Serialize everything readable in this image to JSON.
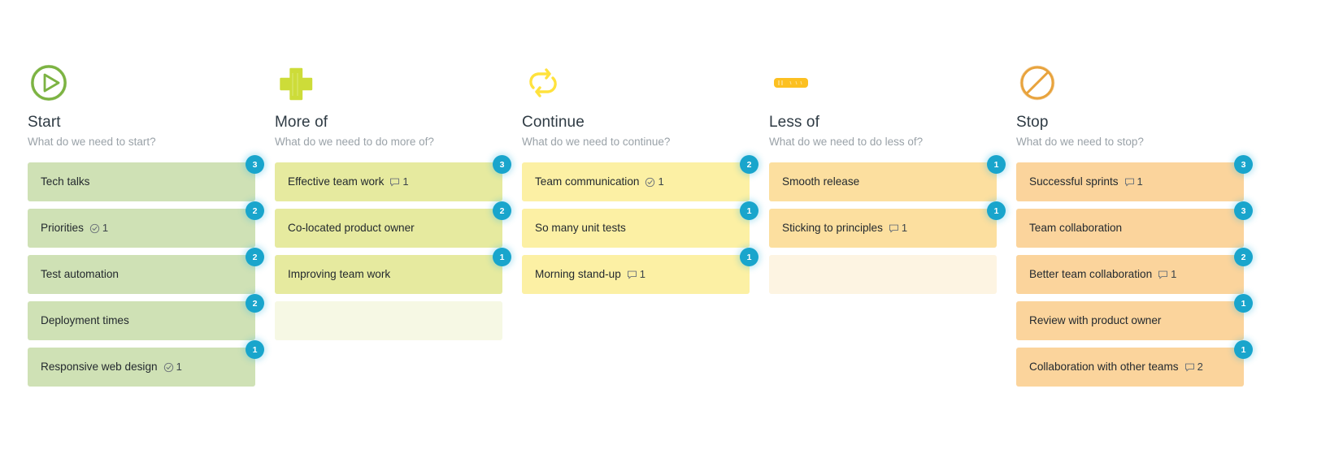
{
  "board": {
    "columns": [
      {
        "id": "start",
        "icon": "play-circle-icon",
        "icon_color": "#7cb342",
        "title": "Start",
        "prompt": "What do we need to start?",
        "card_color": "#cfe1b5",
        "cards": [
          {
            "text": "Tech talks",
            "badge": "3",
            "meta_icon": "",
            "meta_count": ""
          },
          {
            "text": "Priorities",
            "badge": "2",
            "meta_icon": "check-circle-icon",
            "meta_count": "1"
          },
          {
            "text": "Test automation",
            "badge": "2",
            "meta_icon": "",
            "meta_count": ""
          },
          {
            "text": "Deployment times",
            "badge": "2",
            "meta_icon": "",
            "meta_count": ""
          },
          {
            "text": "Responsive web design",
            "badge": "1",
            "meta_icon": "check-circle-icon",
            "meta_count": "1"
          }
        ]
      },
      {
        "id": "moreof",
        "icon": "plus-cross-icon",
        "icon_color": "#cddc39",
        "title": "More of",
        "prompt": "What do we need to do more of?",
        "card_color": "#e6ea9f",
        "cards": [
          {
            "text": "Effective team work",
            "badge": "3",
            "meta_icon": "comment-icon",
            "meta_count": "1"
          },
          {
            "text": "Co-located product owner",
            "badge": "2",
            "meta_icon": "",
            "meta_count": ""
          },
          {
            "text": "Improving team work",
            "badge": "1",
            "meta_icon": "",
            "meta_count": ""
          },
          {
            "text": "",
            "badge": "",
            "meta_icon": "",
            "meta_count": "",
            "empty": true
          }
        ]
      },
      {
        "id": "continue",
        "icon": "recycle-arrows-icon",
        "icon_color": "#ffe23d",
        "title": "Continue",
        "prompt": "What do we need to continue?",
        "card_color": "#fcf0a4",
        "cards": [
          {
            "text": "Team communication",
            "badge": "2",
            "meta_icon": "check-circle-icon",
            "meta_count": "1"
          },
          {
            "text": "So many unit tests",
            "badge": "1",
            "meta_icon": "",
            "meta_count": ""
          },
          {
            "text": "Morning stand-up",
            "badge": "1",
            "meta_icon": "comment-icon",
            "meta_count": "1"
          }
        ]
      },
      {
        "id": "lessof",
        "icon": "minus-bar-icon",
        "icon_color": "#fcc021",
        "title": "Less of",
        "prompt": "What do we need to do less of?",
        "card_color": "#fcdf9f",
        "cards": [
          {
            "text": "Smooth release",
            "badge": "1",
            "meta_icon": "",
            "meta_count": ""
          },
          {
            "text": "Sticking to principles",
            "badge": "1",
            "meta_icon": "comment-icon",
            "meta_count": "1"
          },
          {
            "text": "",
            "badge": "",
            "meta_icon": "",
            "meta_count": "",
            "empty": true
          }
        ]
      },
      {
        "id": "stop",
        "icon": "prohibition-sign-icon",
        "icon_color": "#e8a33d",
        "title": "Stop",
        "prompt": "What do we need to stop?",
        "card_color": "#fbd49c",
        "cards": [
          {
            "text": "Successful sprints",
            "badge": "3",
            "meta_icon": "comment-icon",
            "meta_count": "1"
          },
          {
            "text": "Team collaboration",
            "badge": "3",
            "meta_icon": "",
            "meta_count": ""
          },
          {
            "text": "Better team collaboration",
            "badge": "2",
            "meta_icon": "comment-icon",
            "meta_count": "1"
          },
          {
            "text": "Review with product owner",
            "badge": "1",
            "meta_icon": "",
            "meta_count": ""
          },
          {
            "text": "Collaboration with other teams",
            "badge": "1",
            "meta_icon": "comment-icon",
            "meta_count": "2"
          }
        ]
      }
    ],
    "badge_color": "#19a5cc"
  }
}
